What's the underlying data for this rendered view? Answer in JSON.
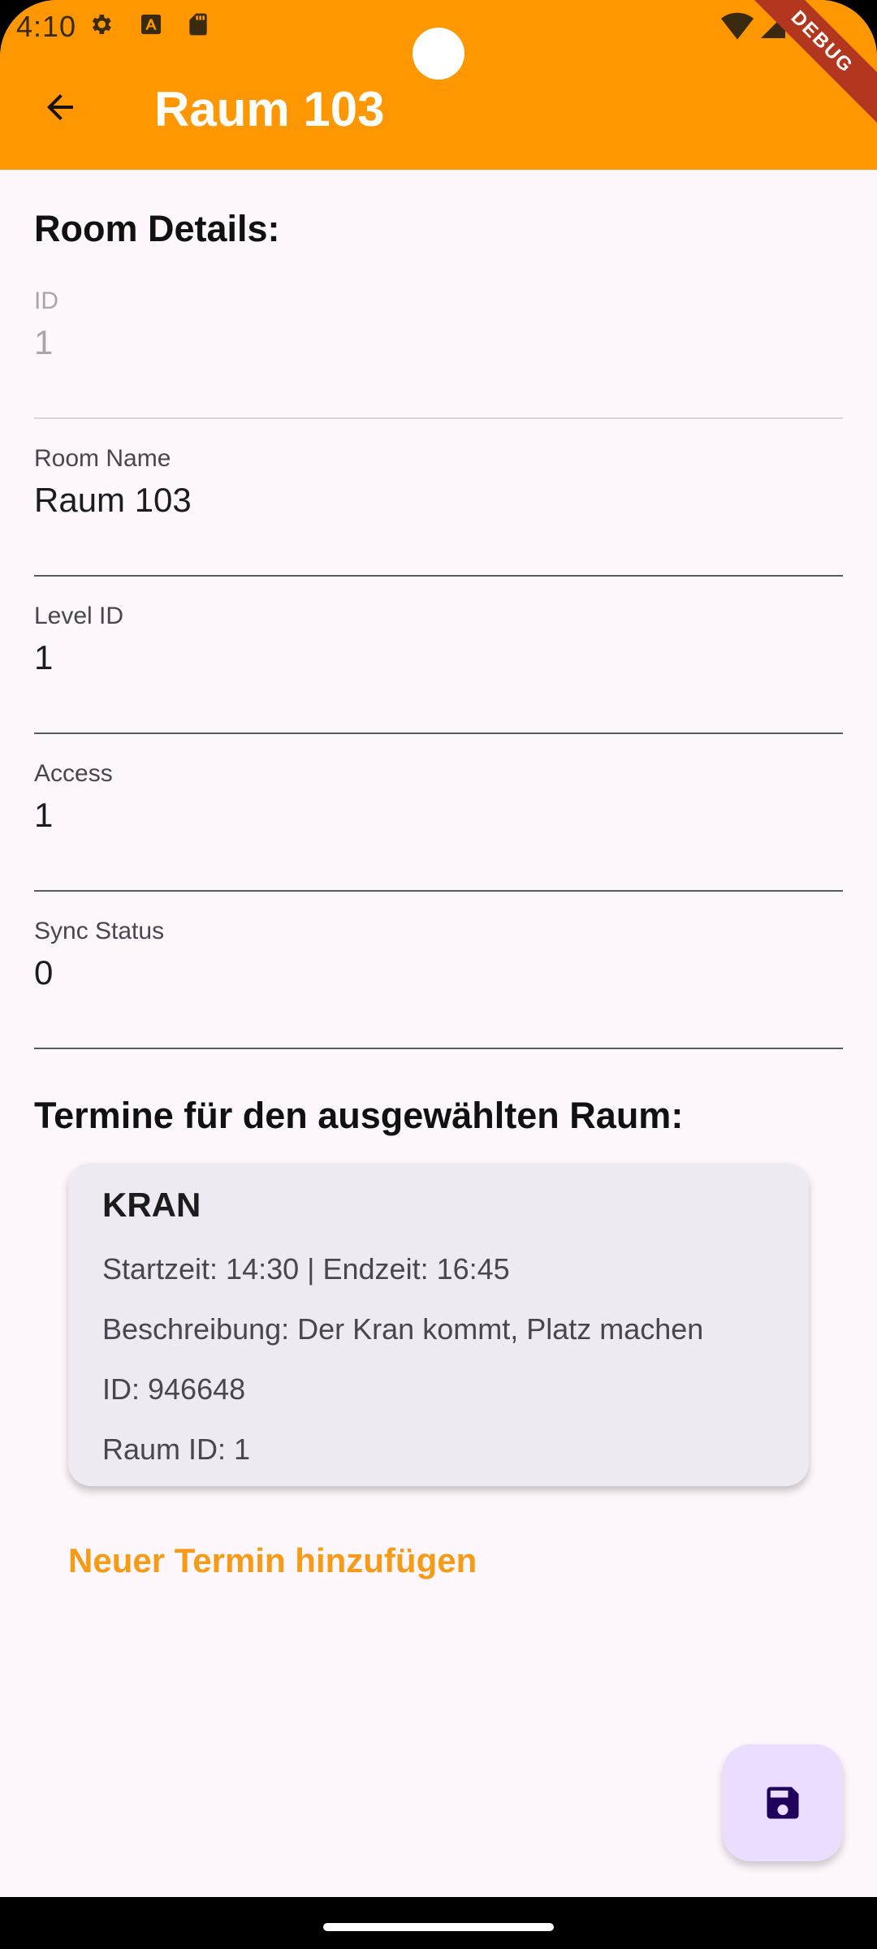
{
  "status_bar": {
    "time": "4:10",
    "icons": [
      "gear-icon",
      "font-download-icon",
      "sd-card-icon",
      "wifi-icon",
      "signal-icon"
    ]
  },
  "app_bar": {
    "title": "Raum 103",
    "back_icon": "arrow-back-icon",
    "debug_label": "DEBUG",
    "color": "#ff9800"
  },
  "room_details": {
    "heading": "Room Details:",
    "fields": [
      {
        "label": "ID",
        "value": "1",
        "enabled": false
      },
      {
        "label": "Room Name",
        "value": "Raum 103",
        "enabled": true
      },
      {
        "label": "Level ID",
        "value": "1",
        "enabled": true
      },
      {
        "label": "Access",
        "value": "1",
        "enabled": true
      },
      {
        "label": "Sync Status",
        "value": "0",
        "enabled": true
      }
    ]
  },
  "appointments": {
    "heading": "Termine für den ausgewählten Raum:",
    "items": [
      {
        "title": "KRAN",
        "time": "Startzeit: 14:30 | Endzeit: 16:45",
        "description": "Beschreibung: Der Kran kommt, Platz machen",
        "id": "ID: 946648",
        "room_id": "Raum ID: 1"
      }
    ],
    "add_label": "Neuer Termin hinzufügen",
    "accent": "#f59b18"
  },
  "fab": {
    "icon": "save-icon",
    "background": "#eaddff"
  }
}
